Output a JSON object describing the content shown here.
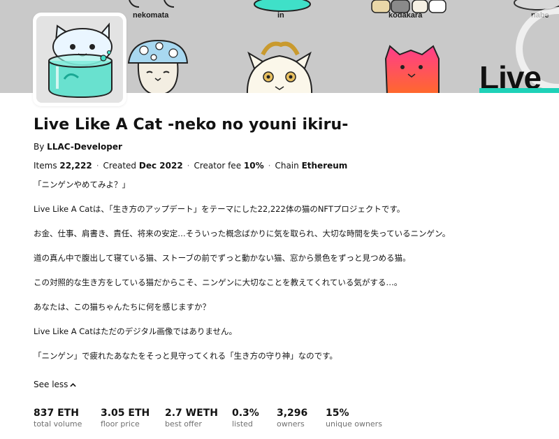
{
  "banner": {
    "labels": [
      "nekomata",
      "in",
      "kodakara",
      "nabe"
    ],
    "big_text": "Live L",
    "accent_color": "#1fd1b8"
  },
  "collection": {
    "title": "Live Like A Cat -neko no youni ikiru-",
    "by_prefix": "By",
    "creator": "LLAC-Developer",
    "meta": {
      "items_label": "Items",
      "items_value": "22,222",
      "created_label": "Created",
      "created_value": "Dec 2022",
      "fee_label": "Creator fee",
      "fee_value": "10%",
      "chain_label": "Chain",
      "chain_value": "Ethereum"
    },
    "description": [
      "「ニンゲンやめてみよ？」",
      "Live Like A Catは、「生き方のアップデート」をテーマにした22,222体の猫のNFTプロジェクトです。",
      "お金、仕事、肩書き、責任、将来の安定…そういった概念ばかりに気を取られ、大切な時間を失っているニンゲン。",
      "道の真ん中で腹出して寝ている猫、ストーブの前でずっと動かない猫、窓から景色をずっと見つめる猫。",
      "この対照的な生き方をしている猫だからこそ、ニンゲンに大切なことを教えてくれている気がする…。",
      "あなたは、この猫ちゃんたちに何を感じますか？",
      "Live Like A Catはただのデジタル画像ではありません。",
      "「ニンゲン」で疲れたあなたをそっと見守ってくれる「生き方の守り神」なのです。"
    ],
    "see_less": "See less",
    "stats": [
      {
        "value": "837 ETH",
        "label": "total volume"
      },
      {
        "value": "3.05 ETH",
        "label": "floor price"
      },
      {
        "value": "2.7 WETH",
        "label": "best offer"
      },
      {
        "value": "0.3%",
        "label": "listed"
      },
      {
        "value": "3,296",
        "label": "owners"
      },
      {
        "value": "15%",
        "label": "unique owners"
      }
    ]
  }
}
